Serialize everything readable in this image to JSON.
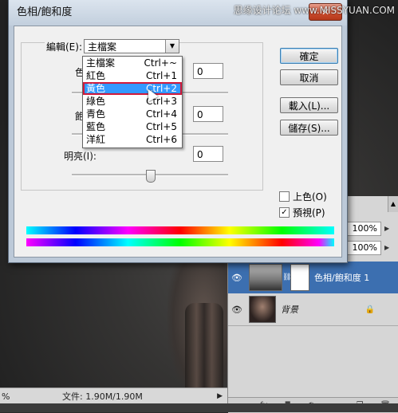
{
  "watermark": "思缘设计论坛 www.MISSYUAN.COM",
  "dialog": {
    "title": "色相/飽和度",
    "close_glyph": "✕",
    "edit_label": "編輯(E):",
    "edit_value": "主檔案",
    "hue_label": "色相",
    "sat_label": "飽和",
    "light_label": "明亮(I):",
    "hue_value": "0",
    "sat_value": "0",
    "light_value": "0",
    "buttons": {
      "ok": "確定",
      "cancel": "取消",
      "load": "載入(L)...",
      "save": "儲存(S)..."
    },
    "colorize_label": "上色(O)",
    "colorize_checked": false,
    "preview_label": "預視(P)",
    "preview_checked": true
  },
  "dropdown": {
    "items": [
      {
        "name": "主檔案",
        "key": "Ctrl+~"
      },
      {
        "name": "紅色",
        "key": "Ctrl+1"
      },
      {
        "name": "黃色",
        "key": "Ctrl+2"
      },
      {
        "name": "綠色",
        "key": "Ctrl+3"
      },
      {
        "name": "青色",
        "key": "Ctrl+4"
      },
      {
        "name": "藍色",
        "key": "Ctrl+5"
      },
      {
        "name": "洋紅",
        "key": "Ctrl+6"
      }
    ],
    "selected_index": 2
  },
  "status": {
    "zoom": "%",
    "doc": "文件: 1.90M/1.90M"
  },
  "layers": {
    "opacity": "100%",
    "fill": "100%",
    "rows": [
      {
        "name": "色相/飽和度 1",
        "active": true
      },
      {
        "name": "背景",
        "active": false,
        "locked": true
      }
    ]
  },
  "colors": {
    "selection": "#3399ff",
    "selection_outline": "#d11a3a",
    "active_layer": "#3c6fb0"
  }
}
